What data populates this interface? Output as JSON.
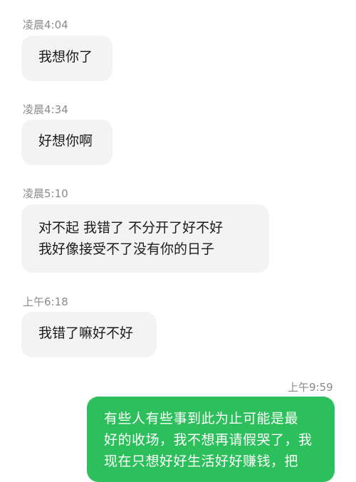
{
  "messages": [
    {
      "time": "凌晨4:04",
      "lines": [
        "我想你了"
      ],
      "sender": "other"
    },
    {
      "time": "凌晨4:34",
      "lines": [
        "好想你啊"
      ],
      "sender": "other"
    },
    {
      "time": "凌晨5:10",
      "lines": [
        "对不起 我错了 不分开了好不好",
        "我好像接受不了没有你的日子"
      ],
      "sender": "other"
    },
    {
      "time": "上午6:18",
      "lines": [
        "我错了嘛好不好"
      ],
      "sender": "other"
    },
    {
      "time": "上午9:59",
      "lines": [
        "有些人有些事到此为止可能是最",
        "好的收场，我不想再请假哭了，我",
        "现在只想好好生活好好赚钱，把"
      ],
      "sender": "self"
    }
  ],
  "colors": {
    "incoming_bubble": "#f3f3f3",
    "outgoing_bubble": "#2dbf5c",
    "timestamp": "#8a8a8a"
  }
}
